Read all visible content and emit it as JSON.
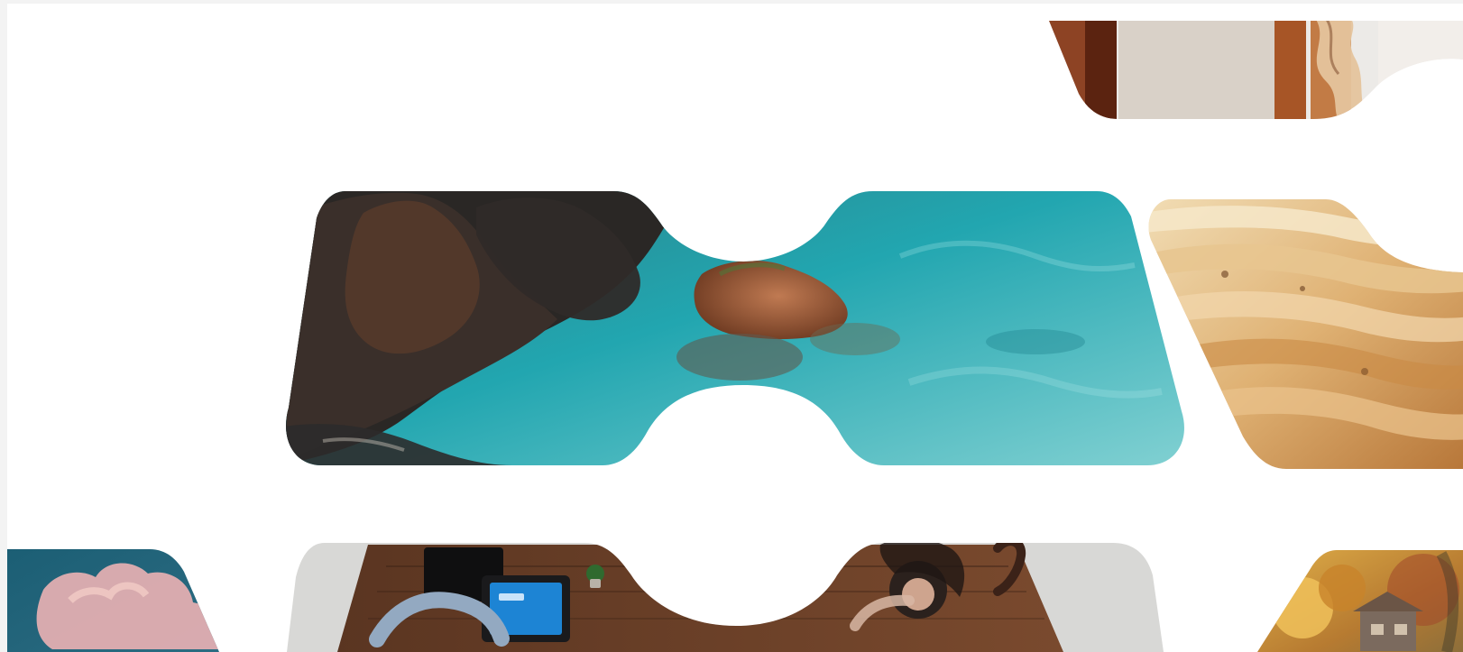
{
  "gallery": {
    "tiles": [
      {
        "id": "fiber-detail",
        "icon": "photo-rust-fiber",
        "colors": [
          "#6c3419",
          "#a65a2f",
          "#e3b98f",
          "#f3eee9"
        ]
      },
      {
        "id": "coastal-rocks",
        "icon": "photo-aerial-coast",
        "colors": [
          "#2a2522",
          "#553b2a",
          "#1ea3b0",
          "#9ed9dc"
        ]
      },
      {
        "id": "pastry-layers",
        "icon": "photo-pastry",
        "colors": [
          "#f0d6a8",
          "#d9a56a",
          "#b6783f",
          "#7a4f2a"
        ]
      },
      {
        "id": "sky-clouds",
        "icon": "photo-sky-clouds",
        "colors": [
          "#1f5f73",
          "#d9a3a4",
          "#f5c6bf"
        ]
      },
      {
        "id": "team-desk",
        "icon": "photo-team-desk",
        "colors": [
          "#d9d9d9",
          "#6f4228",
          "#1d84d4",
          "#3b2b22"
        ]
      },
      {
        "id": "autumn-village",
        "icon": "photo-autumn-village",
        "colors": [
          "#c98a2e",
          "#7b7f3a",
          "#5a4a3d",
          "#b6503a"
        ]
      }
    ]
  }
}
